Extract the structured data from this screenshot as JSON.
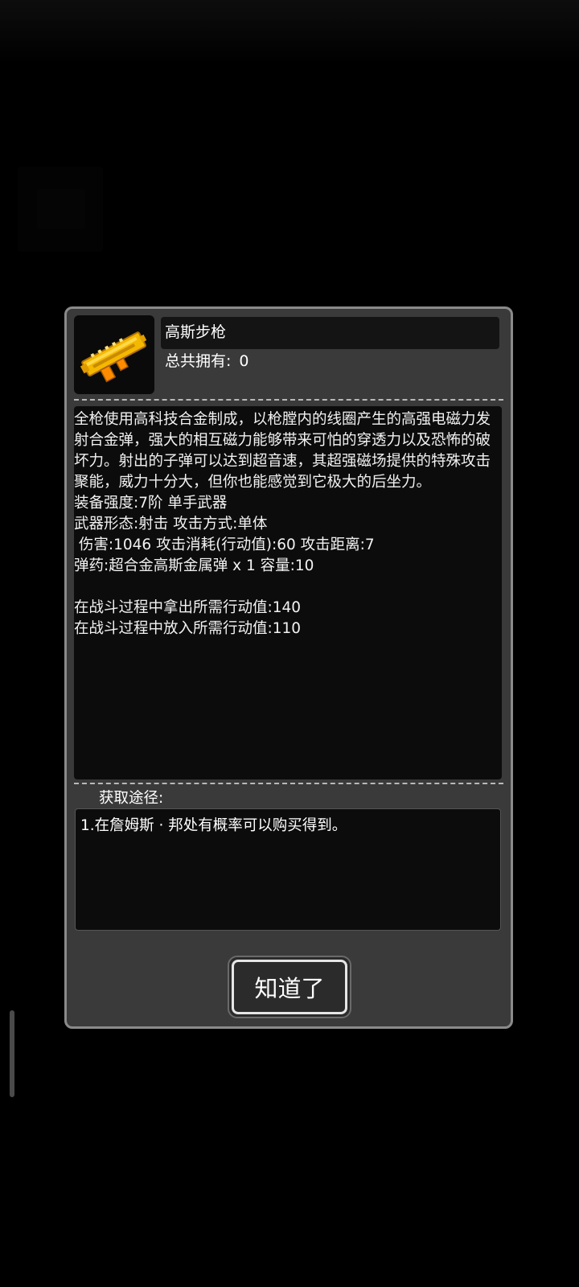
{
  "item": {
    "name": "高斯步枪",
    "owned_label": "总共拥有:",
    "owned_value": "0",
    "icon": "gauss-rifle-icon",
    "icon_colors": [
      "#f5b800",
      "#ff8c00",
      "#ffd84a"
    ]
  },
  "description": "全枪使用高科技合金制成，以枪膛内的线圈产生的高强电磁力发射合金弹，强大的相互磁力能够带来可怕的穿透力以及恐怖的破坏力。射出的子弹可以达到超音速，其超强磁场提供的特殊攻击聚能，威力十分大，但你也能感觉到它极大的后坐力。\n装备强度:7阶 单手武器\n武器形态:射击 攻击方式:单体\n 伤害:1046 攻击消耗(行动值):60 攻击距离:7\n弹药:超合金高斯金属弹 x 1 容量:10\n\n在战斗过程中拿出所需行动值:140\n在战斗过程中放入所需行动值:110",
  "acquisition": {
    "label": "获取途径:",
    "text": "1.在詹姆斯 · 邦处有概率可以购买得到。"
  },
  "button": {
    "label": "知道了"
  }
}
